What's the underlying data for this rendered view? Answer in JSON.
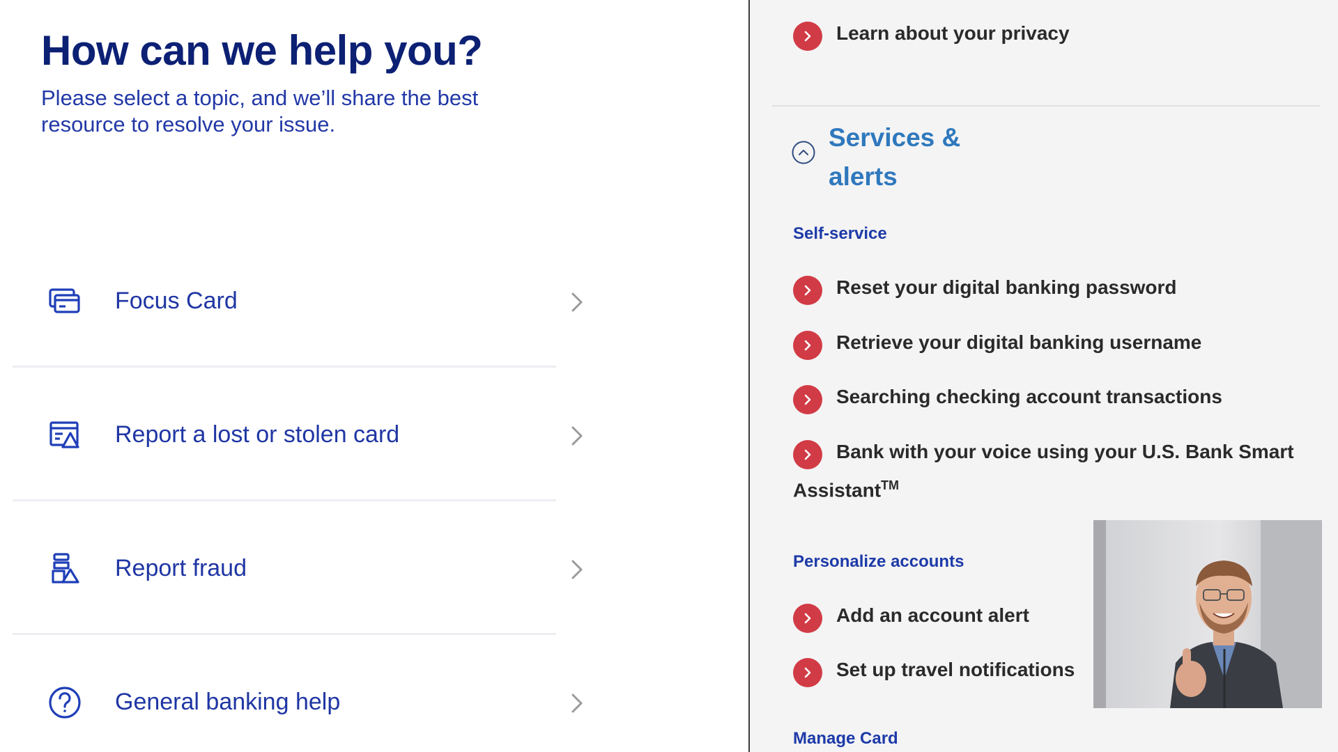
{
  "left": {
    "heading": "How can we help you?",
    "subheading": "Please select a topic, and we’ll share the best resource to resolve your issue.",
    "topics": [
      {
        "label": "Focus Card",
        "icon": "card-icon"
      },
      {
        "label": "Report a lost or stolen card",
        "icon": "card-alert-icon"
      },
      {
        "label": "Report fraud",
        "icon": "fraud-icon"
      },
      {
        "label": "General banking help",
        "icon": "help-circle-icon"
      }
    ]
  },
  "right": {
    "privacy_link": "Learn about your privacy",
    "accordion_title": "Services & alerts",
    "self_service": {
      "heading": "Self-service",
      "items": [
        "Reset your digital banking password",
        "Retrieve your digital banking username",
        "Searching checking account transactions"
      ],
      "smart_assistant_line1": "Bank with your voice using your U.S. Bank Smart",
      "smart_assistant_line2": "Assistant",
      "smart_assistant_tm": "TM"
    },
    "personalize": {
      "heading": "Personalize accounts",
      "items": [
        "Add an account alert",
        "Set up travel notifications"
      ]
    },
    "manage_card_heading": "Manage Card"
  },
  "colors": {
    "heading_navy": "#0c2074",
    "link_blue": "#1f36a3",
    "accordion_blue": "#2f78bd",
    "badge_red": "#d13b45",
    "right_bg": "#f4f4f4"
  }
}
